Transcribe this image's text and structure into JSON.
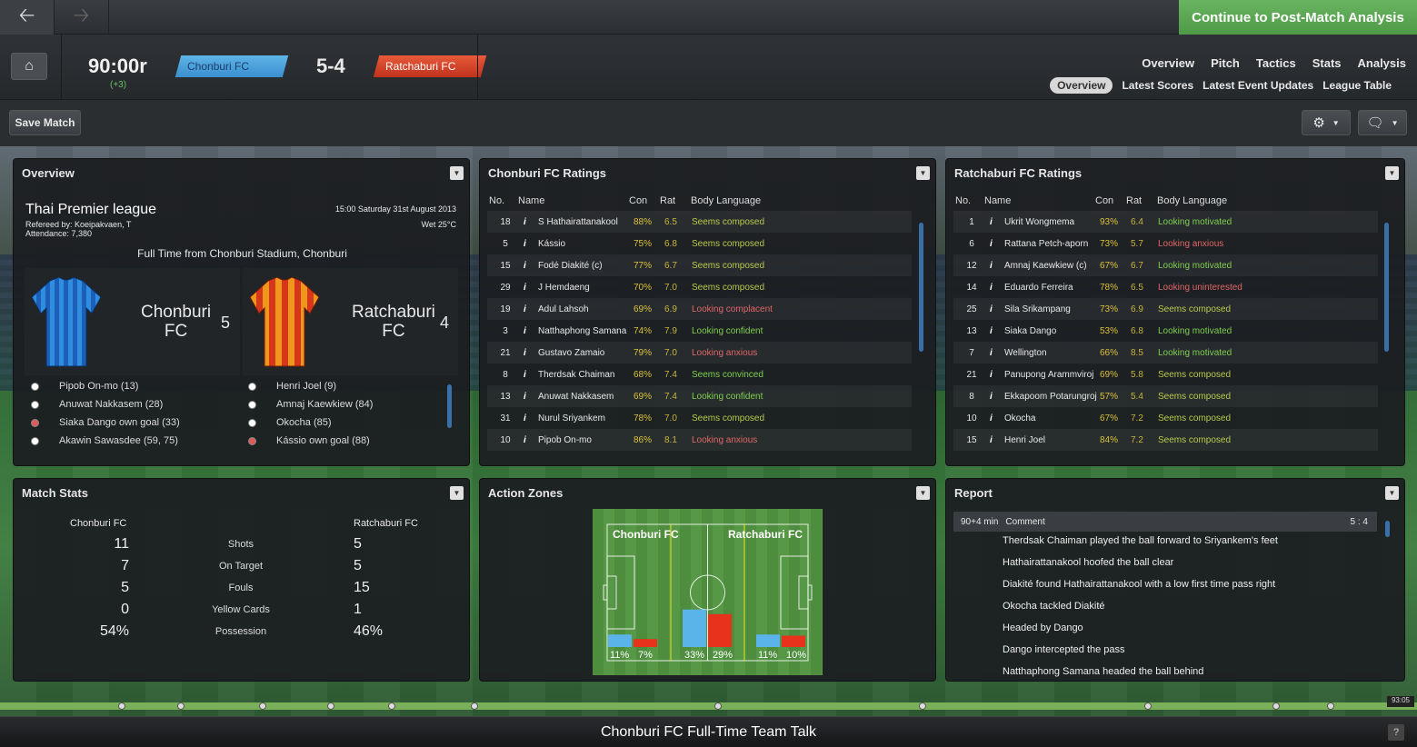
{
  "topbar": {
    "continue_label": "Continue to Post-Match Analysis"
  },
  "header": {
    "time": "90:00r",
    "added": "(+3)",
    "home_team": "Chonburi FC",
    "away_team": "Ratchaburi FC",
    "score": "5-4",
    "nav": [
      "Overview",
      "Pitch",
      "Tactics",
      "Stats",
      "Analysis"
    ],
    "subnav": [
      "Overview",
      "Latest Scores",
      "Latest Event Updates",
      "League Table"
    ],
    "subnav_active": "Overview"
  },
  "toolbar": {
    "save_label": "Save Match"
  },
  "overview": {
    "title": "Overview",
    "competition": "Thai Premier league",
    "kickoff": "15:00 Saturday 31st August 2013",
    "referee": "Refereed by: Koeipakvaen, T",
    "weather": "Wet 25°C",
    "attendance": "Attendance: 7,380",
    "venue_line": "Full Time from Chonburi Stadium, Chonburi",
    "home_name_1": "Chonburi",
    "home_name_2": "FC",
    "home_goals": "5",
    "away_name_1": "Ratchaburi",
    "away_name_2": "FC",
    "away_goals": "4",
    "home_scorers": [
      {
        "text": "Pipob On-mo (13)",
        "og": false
      },
      {
        "text": "Anuwat Nakkasem (28)",
        "og": false
      },
      {
        "text": "Siaka Dango own goal (33)",
        "og": true
      },
      {
        "text": "Akawin Sawasdee (59, 75)",
        "og": false
      }
    ],
    "away_scorers": [
      {
        "text": "Henri Joel (9)",
        "og": false
      },
      {
        "text": "Amnaj Kaewkiew (84)",
        "og": false
      },
      {
        "text": "Okocha (85)",
        "og": false
      },
      {
        "text": "Kássio own goal (88)",
        "og": true
      }
    ]
  },
  "home_ratings": {
    "title": "Chonburi FC Ratings",
    "headers": [
      "No.",
      "Name",
      "Con",
      "Rat",
      "Body Language"
    ],
    "rows": [
      {
        "no": "18",
        "name": "S Hathairattanakool",
        "con": "88%",
        "rat": "6.5",
        "body": "Seems composed",
        "color": "#b9c94a"
      },
      {
        "no": "5",
        "name": "Kássio",
        "con": "75%",
        "rat": "6.8",
        "body": "Seems composed",
        "color": "#b9c94a"
      },
      {
        "no": "15",
        "name": "Fodé Diakité (c)",
        "con": "77%",
        "rat": "6.7",
        "body": "Seems composed",
        "color": "#b9c94a"
      },
      {
        "no": "29",
        "name": "J Hemdaeng",
        "con": "70%",
        "rat": "7.0",
        "body": "Seems composed",
        "color": "#b9c94a"
      },
      {
        "no": "19",
        "name": "Adul Lahsoh",
        "con": "69%",
        "rat": "6.9",
        "body": "Looking complacent",
        "color": "#e06666"
      },
      {
        "no": "3",
        "name": "Natthaphong Samana",
        "con": "74%",
        "rat": "7.9",
        "body": "Looking confident",
        "color": "#7fcf4e"
      },
      {
        "no": "21",
        "name": "Gustavo Zamaio",
        "con": "79%",
        "rat": "7.0",
        "body": "Looking anxious",
        "color": "#e06666"
      },
      {
        "no": "8",
        "name": "Therdsak Chaiman",
        "con": "68%",
        "rat": "7.4",
        "body": "Seems convinced",
        "color": "#7fcf4e"
      },
      {
        "no": "13",
        "name": "Anuwat Nakkasem",
        "con": "69%",
        "rat": "7.4",
        "body": "Looking confident",
        "color": "#7fcf4e"
      },
      {
        "no": "31",
        "name": "Nurul Sriyankem",
        "con": "78%",
        "rat": "7.0",
        "body": "Seems composed",
        "color": "#b9c94a"
      },
      {
        "no": "10",
        "name": "Pipob On-mo",
        "con": "86%",
        "rat": "8.1",
        "body": "Looking anxious",
        "color": "#e06666"
      }
    ]
  },
  "away_ratings": {
    "title": "Ratchaburi FC Ratings",
    "headers": [
      "No.",
      "Name",
      "Con",
      "Rat",
      "Body Language"
    ],
    "rows": [
      {
        "no": "1",
        "name": "Ukrit Wongmema",
        "con": "93%",
        "rat": "6.4",
        "body": "Looking motivated",
        "color": "#7fcf4e"
      },
      {
        "no": "6",
        "name": "Rattana Petch-aporn",
        "con": "73%",
        "rat": "5.7",
        "body": "Looking anxious",
        "color": "#e06666"
      },
      {
        "no": "12",
        "name": "Amnaj Kaewkiew (c)",
        "con": "67%",
        "rat": "6.7",
        "body": "Looking motivated",
        "color": "#7fcf4e"
      },
      {
        "no": "14",
        "name": "Eduardo Ferreira",
        "con": "78%",
        "rat": "6.5",
        "body": "Looking uninterested",
        "color": "#e06666"
      },
      {
        "no": "25",
        "name": "Sila Srikampang",
        "con": "73%",
        "rat": "6.9",
        "body": "Seems composed",
        "color": "#b9c94a"
      },
      {
        "no": "13",
        "name": "Siaka Dango",
        "con": "53%",
        "rat": "6.8",
        "body": "Looking motivated",
        "color": "#7fcf4e"
      },
      {
        "no": "7",
        "name": "Wellington",
        "con": "66%",
        "rat": "8.5",
        "body": "Looking motivated",
        "color": "#7fcf4e"
      },
      {
        "no": "21",
        "name": "Panupong Arammviroj",
        "con": "69%",
        "rat": "5.8",
        "body": "Seems composed",
        "color": "#b9c94a"
      },
      {
        "no": "8",
        "name": "Ekkapoom Potarungroj",
        "con": "57%",
        "rat": "5.4",
        "body": "Seems composed",
        "color": "#b9c94a"
      },
      {
        "no": "10",
        "name": "Okocha",
        "con": "67%",
        "rat": "7.2",
        "body": "Seems composed",
        "color": "#b9c94a"
      },
      {
        "no": "15",
        "name": "Henri Joel",
        "con": "84%",
        "rat": "7.2",
        "body": "Seems composed",
        "color": "#b9c94a"
      }
    ]
  },
  "match_stats": {
    "title": "Match Stats",
    "home": "Chonburi FC",
    "away": "Ratchaburi FC",
    "rows": [
      {
        "label": "Shots",
        "home": "11",
        "away": "5"
      },
      {
        "label": "On Target",
        "home": "7",
        "away": "5"
      },
      {
        "label": "Fouls",
        "home": "5",
        "away": "15"
      },
      {
        "label": "Yellow Cards",
        "home": "0",
        "away": "1"
      },
      {
        "label": "Possession",
        "home": "54%",
        "away": "46%"
      }
    ]
  },
  "action_zones": {
    "title": "Action Zones",
    "home_label": "Chonburi FC",
    "away_label": "Ratchaburi FC",
    "zones": [
      {
        "home": 11,
        "away": 7,
        "home_label": "11%",
        "away_label": "7%"
      },
      {
        "home": 33,
        "away": 29,
        "home_label": "33%",
        "away_label": "29%"
      },
      {
        "home": 11,
        "away": 10,
        "home_label": "11%",
        "away_label": "10%"
      }
    ],
    "home_color": "#5ab4ea",
    "away_color": "#e8321c"
  },
  "report": {
    "title": "Report",
    "minute": "90+4 min",
    "comment_header": "Comment",
    "score": "5 : 4",
    "lines": [
      "Therdsak Chaiman played the ball forward to Sriyankem's feet",
      "Hathairattanakool hoofed the ball clear",
      "Diakité found Hathairattanakool with a low first time pass right",
      "Okocha tackled Diakité",
      "Headed by Dango",
      "Dango intercepted the pass",
      "Natthaphong Samana headed the ball behind"
    ]
  },
  "bottom": {
    "team_talk": "Chonburi FC Full-Time Team Talk",
    "help": "?",
    "clock": "93:05"
  }
}
